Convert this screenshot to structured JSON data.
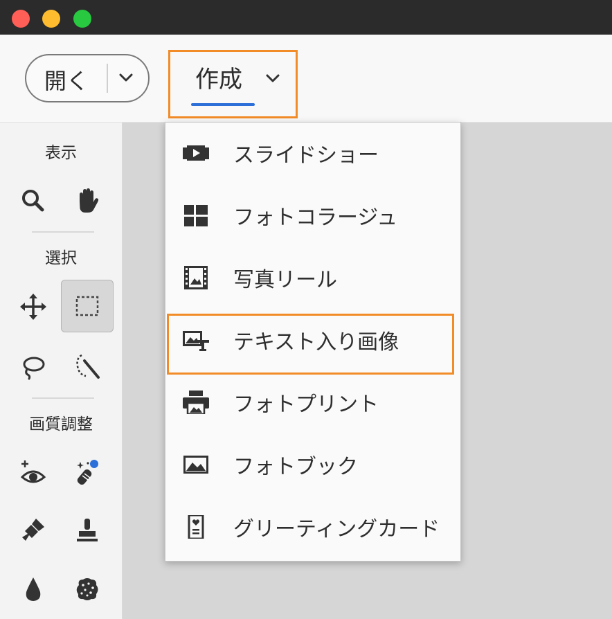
{
  "window": {
    "traffic_lights": {
      "close": "#ff5f57",
      "minimize": "#febc2e",
      "zoom": "#28c840"
    }
  },
  "toolbar": {
    "open_label": "開く",
    "create_label": "作成",
    "accent_color": "#2d6fd8",
    "highlight_color": "#f28c28"
  },
  "tools_panel": {
    "view_title": "表示",
    "select_title": "選択",
    "adjust_title": "画質調整",
    "tools": [
      {
        "name": "zoom-tool",
        "icon": "search-icon"
      },
      {
        "name": "hand-tool",
        "icon": "hand-icon"
      },
      {
        "name": "move-tool",
        "icon": "move-arrows-icon"
      },
      {
        "name": "marquee-tool",
        "icon": "rectangle-marquee-icon",
        "selected": true
      },
      {
        "name": "lasso-tool",
        "icon": "lasso-icon"
      },
      {
        "name": "quick-selection-tool",
        "icon": "magic-wand-icon"
      },
      {
        "name": "red-eye-tool",
        "icon": "eye-plus-icon"
      },
      {
        "name": "spot-healing-tool",
        "icon": "healing-brush-icon"
      },
      {
        "name": "smart-brush-tool",
        "icon": "paint-brush-icon"
      },
      {
        "name": "clone-stamp-tool",
        "icon": "stamp-icon"
      },
      {
        "name": "blur-tool",
        "icon": "drop-icon"
      },
      {
        "name": "sponge-tool",
        "icon": "sponge-icon"
      }
    ]
  },
  "create_menu": {
    "items": [
      {
        "label": "スライドショー",
        "icon": "slideshow-icon"
      },
      {
        "label": "フォトコラージュ",
        "icon": "collage-icon"
      },
      {
        "label": "写真リール",
        "icon": "photo-reel-icon"
      },
      {
        "label": "テキスト入り画像",
        "icon": "image-text-icon",
        "highlighted": true
      },
      {
        "label": "フォトプリント",
        "icon": "printer-icon"
      },
      {
        "label": "フォトブック",
        "icon": "photo-book-icon"
      },
      {
        "label": "グリーティングカード",
        "icon": "greeting-card-icon"
      }
    ]
  }
}
